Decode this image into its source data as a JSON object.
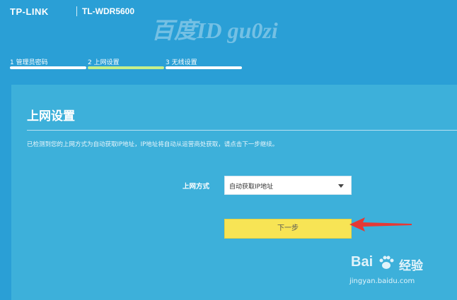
{
  "header": {
    "brand": "TP-LINK",
    "model": "TL-WDR5600"
  },
  "watermark": "百度ID gu0zi",
  "steps": [
    {
      "label": "1 管理员密码",
      "state": "done"
    },
    {
      "label": "2 上网设置",
      "state": "active"
    },
    {
      "label": "3 无线设置",
      "state": "pending"
    }
  ],
  "panel": {
    "title": "上网设置",
    "description": "已检测到您的上网方式为自动获取IP地址，IP地址将自动从运营商处获取，请点击下一步继续。",
    "form": {
      "label": "上网方式",
      "selected": "自动获取IP地址"
    },
    "next_button": "下一步"
  },
  "baidu": {
    "logo_text": "Bai",
    "cn_text": "经验",
    "url": "jingyan.baidu.com"
  },
  "colors": {
    "background": "#2a9fd6",
    "panel": "#3db0da",
    "active_step": "#c5ef8b",
    "button": "#f7e455",
    "arrow": "#e53935"
  }
}
